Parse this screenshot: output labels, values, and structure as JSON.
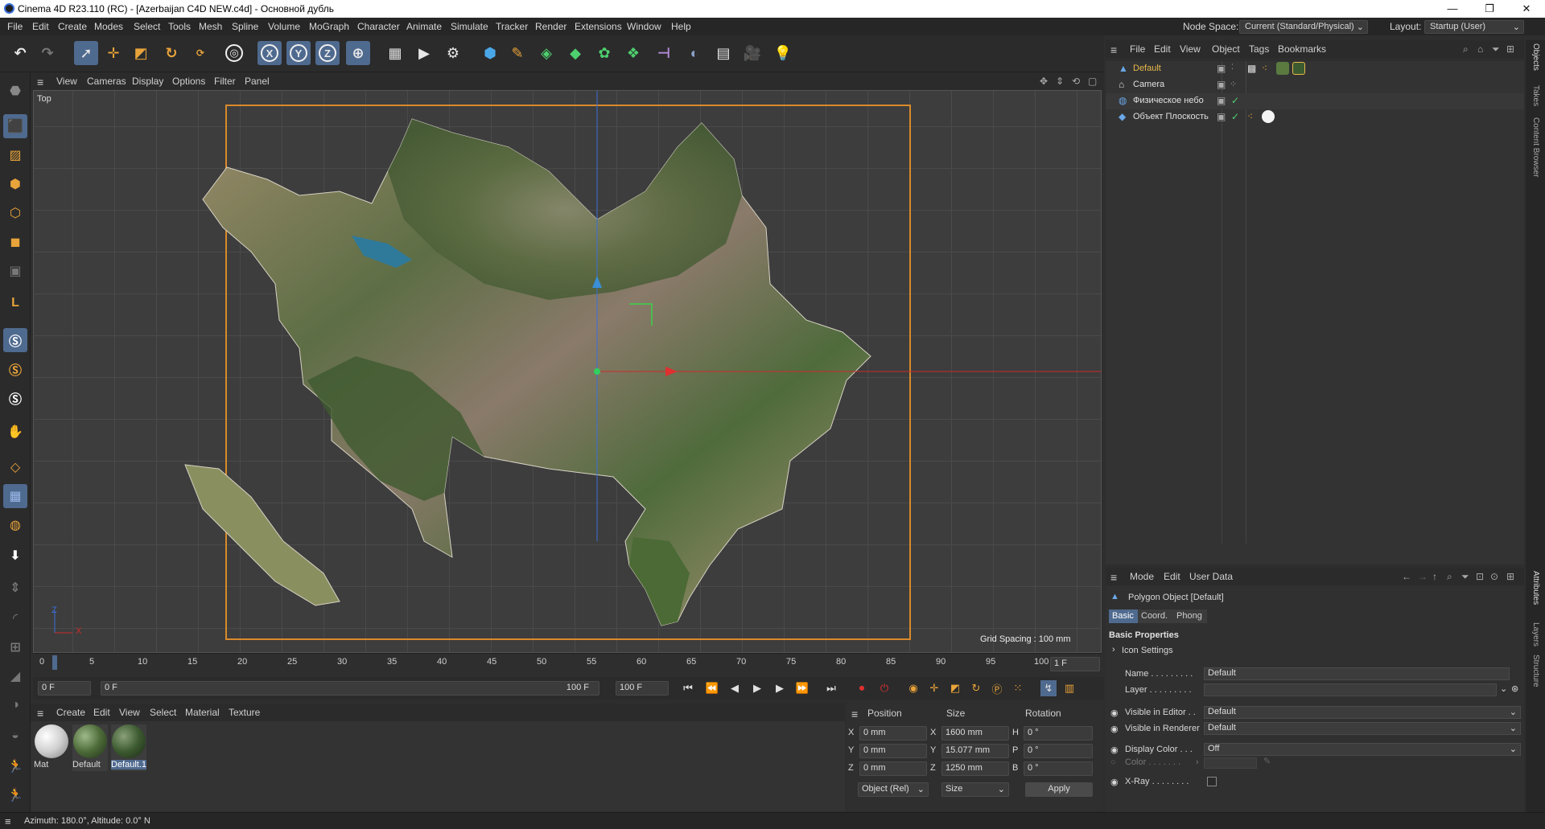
{
  "window": {
    "title": "Cinema 4D R23.110 (RC) - [Azerbaijan C4D NEW.c4d] - Основной дубль",
    "min": "—",
    "max": "❐",
    "close": "✕"
  },
  "menubar": {
    "items": [
      "File",
      "Edit",
      "Create",
      "Modes",
      "Select",
      "Tools",
      "Mesh",
      "Spline",
      "Volume",
      "MoGraph",
      "Character",
      "Animate",
      "Simulate",
      "Tracker",
      "Render",
      "Extensions",
      "Window",
      "Help"
    ],
    "node_space_label": "Node Space:",
    "node_space_value": "Current (Standard/Physical)",
    "layout_label": "Layout:",
    "layout_value": "Startup (User)"
  },
  "viewport": {
    "menu": [
      "View",
      "Cameras",
      "Display",
      "Options",
      "Filter",
      "Panel"
    ],
    "name": "Top",
    "grid_spacing": "Grid Spacing : 100 mm",
    "axis_z": "Z",
    "axis_x": "X"
  },
  "timeline": {
    "ticks": [
      "0",
      "5",
      "10",
      "15",
      "20",
      "25",
      "30",
      "35",
      "40",
      "45",
      "50",
      "55",
      "60",
      "65",
      "70",
      "75",
      "80",
      "85",
      "90",
      "95",
      "100"
    ],
    "current_frame": "1 F",
    "start": "0 F",
    "range_start": "0 F",
    "range_end": "100 F",
    "end": "100 F"
  },
  "materials": {
    "menu": [
      "Create",
      "Edit",
      "View",
      "Select",
      "Material",
      "Texture"
    ],
    "items": [
      {
        "name": "Mat"
      },
      {
        "name": "Default"
      },
      {
        "name": "Default.1"
      }
    ]
  },
  "coordinates": {
    "headers": [
      "Position",
      "Size",
      "Rotation"
    ],
    "rows": [
      {
        "axis": "X",
        "pos": "0 mm",
        "saxis": "X",
        "size": "1600 mm",
        "raxis": "H",
        "rot": "0 °"
      },
      {
        "axis": "Y",
        "pos": "0 mm",
        "saxis": "Y",
        "size": "15.077 mm",
        "raxis": "P",
        "rot": "0 °"
      },
      {
        "axis": "Z",
        "pos": "0 mm",
        "saxis": "Z",
        "size": "1250 mm",
        "raxis": "B",
        "rot": "0 °"
      }
    ],
    "mode": "Object (Rel)",
    "size_mode": "Size",
    "apply": "Apply"
  },
  "objects": {
    "menu": [
      "File",
      "Edit",
      "View",
      "Object",
      "Tags",
      "Bookmarks"
    ],
    "items": [
      {
        "name": "Default",
        "selected": true
      },
      {
        "name": "Camera",
        "selected": false
      },
      {
        "name": "Физическое небо",
        "selected": false
      },
      {
        "name": "Объект Плоскость",
        "selected": false
      }
    ]
  },
  "attributes": {
    "menu": [
      "Mode",
      "Edit",
      "User Data"
    ],
    "object_label": "Polygon Object [Default]",
    "tabs": [
      "Basic",
      "Coord.",
      "Phong"
    ],
    "section": "Basic Properties",
    "icon_settings": "Icon Settings",
    "name_label": "Name . . . . . . . . .",
    "name_value": "Default",
    "layer_label": "Layer . . . . . . . . .",
    "visible_editor_label": "Visible in Editor . .",
    "visible_editor_value": "Default",
    "visible_renderer_label": "Visible in Renderer",
    "visible_renderer_value": "Default",
    "display_color_label": "Display Color . . .",
    "display_color_value": "Off",
    "color_label": "Color . . . . . . .",
    "xray_label": "X-Ray . . . . . . . ."
  },
  "right_tabs": [
    "Objects",
    "Takes",
    "Content Browser",
    "Attributes",
    "Layers",
    "Structure"
  ],
  "status": "Azimuth: 180.0°, Altitude: 0.0°  N",
  "colors": {
    "accent": "#4f6a8f",
    "frame": "#d98a2b",
    "background": "#2e2e2e"
  }
}
